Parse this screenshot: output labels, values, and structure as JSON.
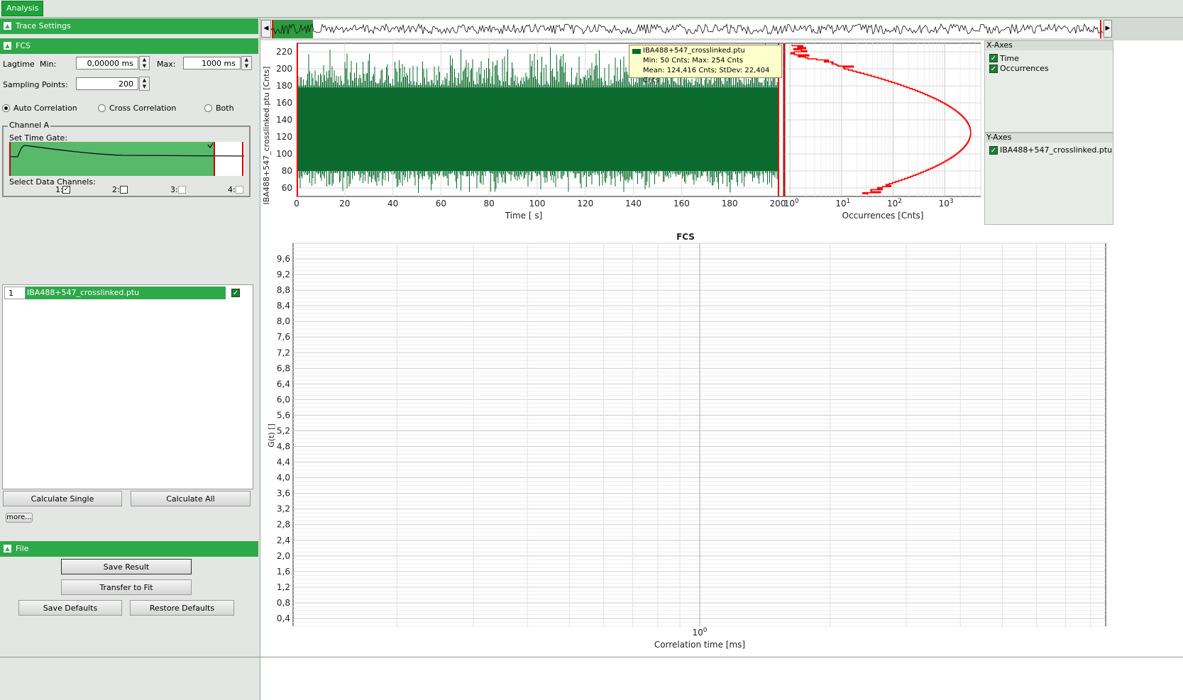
{
  "tab": "Analysis",
  "sections": {
    "trace_settings": "Trace Settings",
    "fcs": "FCS",
    "file": "File"
  },
  "fcs": {
    "lagtime_label": "Lagtime",
    "min_label": "Min:",
    "min_value": "0,00000 ms",
    "max_label": "Max:",
    "max_value": "1000 ms",
    "sampling_label": "Sampling Points:",
    "sampling_value": "200",
    "radio_auto": "Auto Correlation",
    "radio_cross": "Cross Correlation",
    "radio_both": "Both",
    "selected_mode": "Auto Correlation",
    "channel_title": "Channel A",
    "set_time_gate": "Set Time Gate:",
    "select_channels": "Select Data Channels:",
    "channels": [
      {
        "label": "1:",
        "checked": true
      },
      {
        "label": "2:",
        "checked": false
      },
      {
        "label": "3:",
        "checked": false
      },
      {
        "label": "4:",
        "checked": false
      }
    ]
  },
  "file_list": [
    {
      "index": "1",
      "name": "IBA488+547_crosslinked.ptu",
      "checked": true
    }
  ],
  "buttons": {
    "calc_single": "Calculate Single",
    "calc_all": "Calculate All",
    "more": "more...",
    "save_result": "Save Result",
    "transfer": "Transfer to Fit",
    "save_defaults": "Save Defaults",
    "restore_defaults": "Restore Defaults"
  },
  "trace_plot": {
    "ylabel": "IBA488+547_crosslinked.ptu [Cnts]",
    "xlabel": "Time [ s]",
    "yticks": [
      "220",
      "200",
      "180",
      "160",
      "140",
      "120",
      "100",
      "80",
      "60"
    ],
    "xticks": [
      "0",
      "20",
      "40",
      "60",
      "80",
      "100",
      "120",
      "140",
      "160",
      "180",
      "200"
    ],
    "tooltip": {
      "name": "IBA488+547_crosslinked.ptu",
      "line1": "Min: 50  Cnts; Max: 254  Cnts",
      "line2": "Mean: 124,416  Cnts; StDev: 22,404  Cnts"
    }
  },
  "hist_plot": {
    "xlabel": "Occurrences [Cnts]",
    "xticks": [
      {
        "base": "10",
        "exp": "0"
      },
      {
        "base": "10",
        "exp": "1"
      },
      {
        "base": "10",
        "exp": "2"
      },
      {
        "base": "10",
        "exp": "3"
      }
    ]
  },
  "legends": {
    "x_title": "X-Axes",
    "x_items": [
      "Time",
      "Occurrences"
    ],
    "y_title": "Y-Axes",
    "y_items": [
      "IBA488+547_crosslinked.ptu"
    ]
  },
  "chart_data": {
    "type": "line",
    "title": "FCS",
    "xlabel": "Correlation time [ms]",
    "ylabel": "G(t) []",
    "x_scale": "log",
    "x_tick_labels": [
      {
        "base": "10",
        "exp": "0"
      }
    ],
    "ylim": [
      0.2,
      10.0
    ],
    "y_tick_labels": [
      "9,6",
      "9,2",
      "8,8",
      "8,4",
      "8,0",
      "7,6",
      "7,2",
      "6,8",
      "6,4",
      "6,0",
      "5,6",
      "5,2",
      "4,8",
      "4,4",
      "4,0",
      "3,6",
      "3,2",
      "2,8",
      "2,4",
      "2,0",
      "1,6",
      "1,2",
      "0,8",
      "0,4"
    ],
    "grid": true,
    "series": []
  },
  "colors": {
    "accent": "#2fa84a",
    "trace": "#0b6b2e",
    "hist": "#ff0000"
  }
}
